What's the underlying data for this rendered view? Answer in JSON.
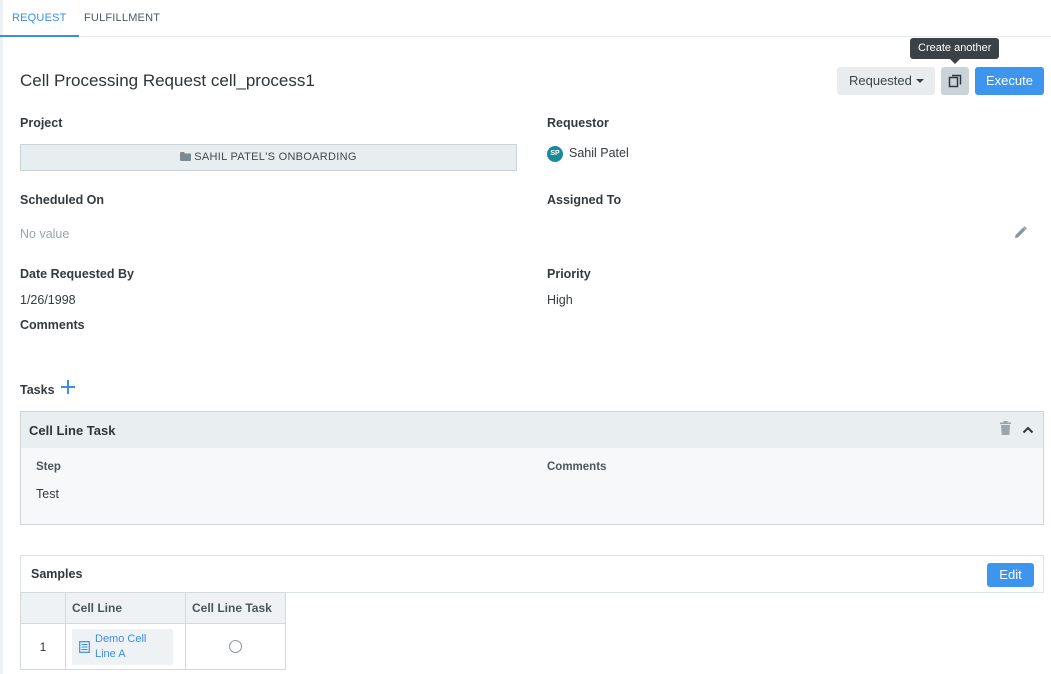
{
  "tabs": [
    {
      "label": "REQUEST",
      "active": true
    },
    {
      "label": "FULFILLMENT",
      "active": false
    }
  ],
  "header": {
    "title": "Cell Processing Request cell_process1",
    "status": "Requested",
    "tooltip": "Create another",
    "execute_label": "Execute"
  },
  "fields": {
    "project_label": "Project",
    "project_value": "SAHIL PATEL'S ONBOARDING",
    "requestor_label": "Requestor",
    "requestor_initials": "SP",
    "requestor_name": "Sahil Patel",
    "scheduled_label": "Scheduled On",
    "scheduled_value": "No value",
    "assigned_label": "Assigned To",
    "date_label": "Date Requested By",
    "date_value": "1/26/1998",
    "priority_label": "Priority",
    "priority_value": "High",
    "comments_label": "Comments"
  },
  "tasks": {
    "label": "Tasks",
    "card": {
      "title": "Cell Line Task",
      "step_label": "Step",
      "step_value": "Test",
      "comments_label": "Comments"
    }
  },
  "samples": {
    "title": "Samples",
    "edit_label": "Edit",
    "columns": [
      "",
      "Cell Line",
      "Cell Line Task"
    ],
    "rows": [
      {
        "index": "1",
        "cell_line": "Demo Cell Line A"
      }
    ]
  },
  "colors": {
    "accent": "#3d95ee",
    "avatar": "#1a8a9a"
  }
}
